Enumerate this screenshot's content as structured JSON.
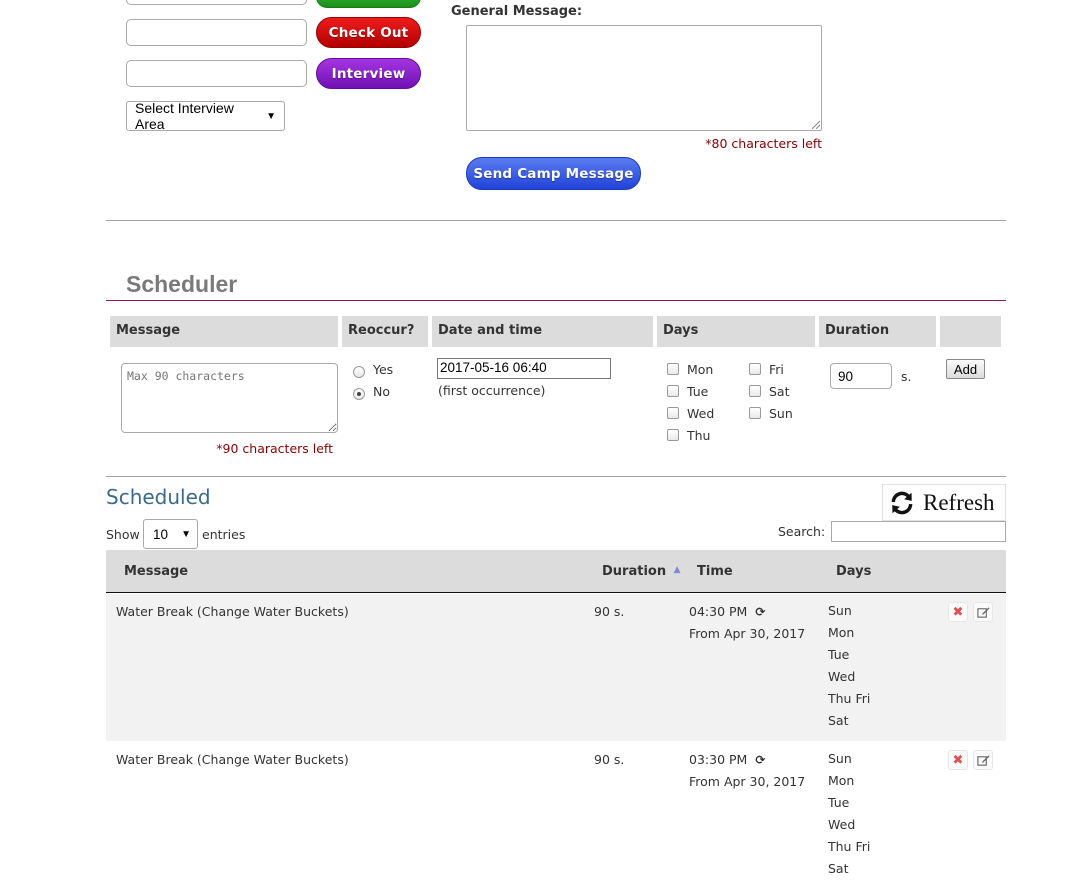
{
  "camp_controls": {
    "check_out_label": "Check Out",
    "interview_label": "Interview",
    "interview_area_select": "Select Interview Area",
    "general_message_label": "General Message:",
    "chars_left": "*80 characters left",
    "send_label": "Send Camp Message"
  },
  "scheduler": {
    "title": "Scheduler",
    "headers": {
      "message": "Message",
      "reoccur": "Reoccur?",
      "date_time": "Date and time",
      "days": "Days",
      "duration": "Duration"
    },
    "message_placeholder": "Max 90 characters",
    "chars_left": "*90 characters left",
    "reoccur_yes": "Yes",
    "reoccur_no": "No",
    "reoccur_selected": "No",
    "datetime_value": "2017-05-16 06:40",
    "first_occurrence": "(first occurrence)",
    "days": [
      "Mon",
      "Tue",
      "Wed",
      "Thu",
      "Fri",
      "Sat",
      "Sun"
    ],
    "duration_value": "90",
    "duration_unit": "s.",
    "add_label": "Add"
  },
  "scheduled": {
    "title": "Scheduled",
    "refresh_label": "Refresh",
    "show_label": "Show",
    "entries_value": "10",
    "entries_label": "entries",
    "search_label": "Search:",
    "columns": {
      "message": "Message",
      "duration": "Duration",
      "time": "Time",
      "days": "Days"
    },
    "rows": [
      {
        "message": "Water Break (Change Water Buckets)",
        "duration": "90 s.",
        "time": "04:30 PM",
        "from": "From Apr 30, 2017",
        "days": [
          "Sun",
          "Mon",
          "Tue",
          "Wed",
          "Thu Fri",
          "Sat"
        ]
      },
      {
        "message": "Water Break (Change Water Buckets)",
        "duration": "90 s.",
        "time": "03:30 PM",
        "from": "From Apr 30, 2017",
        "days": [
          "Sun",
          "Mon",
          "Tue",
          "Wed",
          "Thu Fri",
          "Sat"
        ]
      }
    ]
  },
  "colors": {
    "scheduler_title": "#7a7a7a",
    "scheduler_rule": "#8b1a4a",
    "scheduled_title": "#3a6a8a",
    "chars_left": "#8b0000",
    "delete_icon": "#e05050"
  }
}
